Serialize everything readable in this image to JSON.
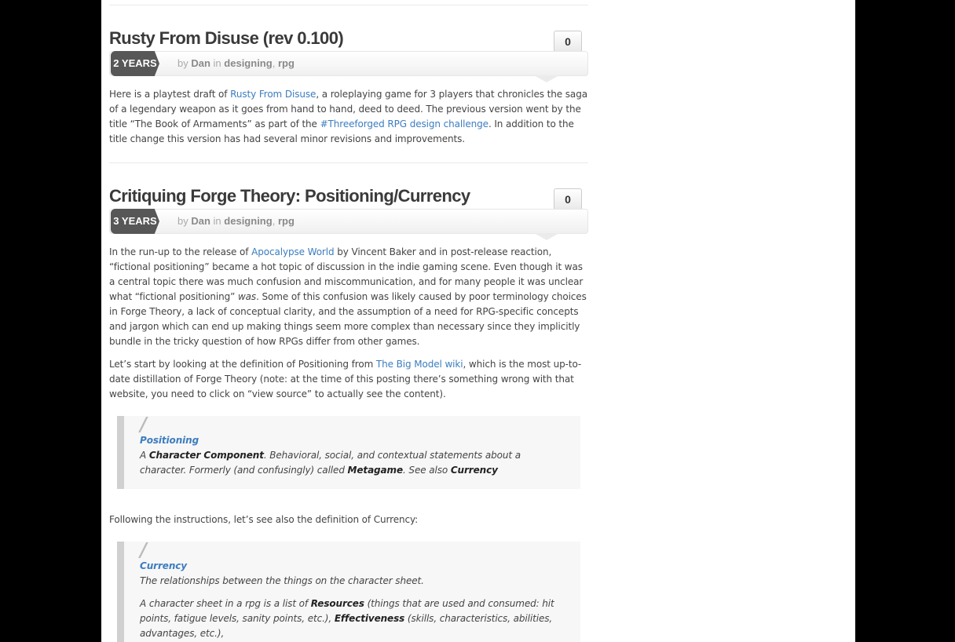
{
  "posts": [
    {
      "title": "Rusty From Disuse (rev 0.100)",
      "comment_count": "0",
      "age": "2 YEARS",
      "by": "by",
      "author": "Dan",
      "in": "in",
      "cat1": "designing",
      "comma": ",",
      "cat2": "rpg",
      "p1": {
        "a": "Here is a playtest draft of ",
        "link1": "Rusty From Disuse",
        "b": ", a roleplaying game for 3 players that chronicles the saga of a legendary weapon as it goes from hand to hand, deed to deed. The previous version went by the title “The Book of Armaments” as part of the ",
        "link2": "#Threeforged RPG design challenge",
        "c": ". In addition to the title change this version has had several minor revisions and improvements."
      }
    },
    {
      "title": "Critiquing Forge Theory: Positioning/Currency",
      "comment_count": "0",
      "age": "3 YEARS",
      "by": "by",
      "author": "Dan",
      "in": "in",
      "cat1": "designing",
      "comma": ",",
      "cat2": "rpg",
      "p1": {
        "a": "In the run-up to the release of ",
        "link1": "Apocalypse World",
        "b": " by Vincent Baker and in post-release reaction, “fictional positioning” became a hot topic of discussion in the indie gaming scene. Even though it was a central topic there was much confusion and miscommunication, and for many people it was unclear what “fictional positioning” ",
        "em": "was",
        "c": ". Some of this confusion was likely caused by poor terminology choices in Forge Theory, a lack of conceptual clarity, and the assumption of a need for RPG-specific concepts and jargon which can end up making things seem more complex than necessary since they implicitly bundle in the tricky question of how RPGs differ from other games."
      },
      "p2": {
        "a": "Let’s start by looking at the definition of Positioning from ",
        "link1": "The Big Model wiki",
        "b": ", which is the most up-to-date distillation of Forge Theory (note: at the time of this posting there’s something wrong with that website, you need to click on “view source” to actually see the content)."
      },
      "quote1": {
        "mark": "/",
        "term": "Positioning",
        "a": "A ",
        "b1": "Character Component",
        "b": ". Behavioral, social, and contextual statements about a character. Formerly (and confusingly) called ",
        "b2": "Metagame",
        "c": ". See also ",
        "b3": "Currency"
      },
      "p3": "Following the instructions, let’s see also the definition of Currency:",
      "quote2": {
        "mark": "/",
        "term": "Currency",
        "line1": "The relationships between the things on the character sheet.",
        "a": "A character sheet in a rpg is a list of ",
        "b1": "Resources",
        "b": " (things that are used and consumed: hit points, fatigue levels, sanity points, etc.), ",
        "b2": "Effectiveness",
        "c": " (skills, characteristics, abilities, advantages, etc.),"
      }
    }
  ]
}
